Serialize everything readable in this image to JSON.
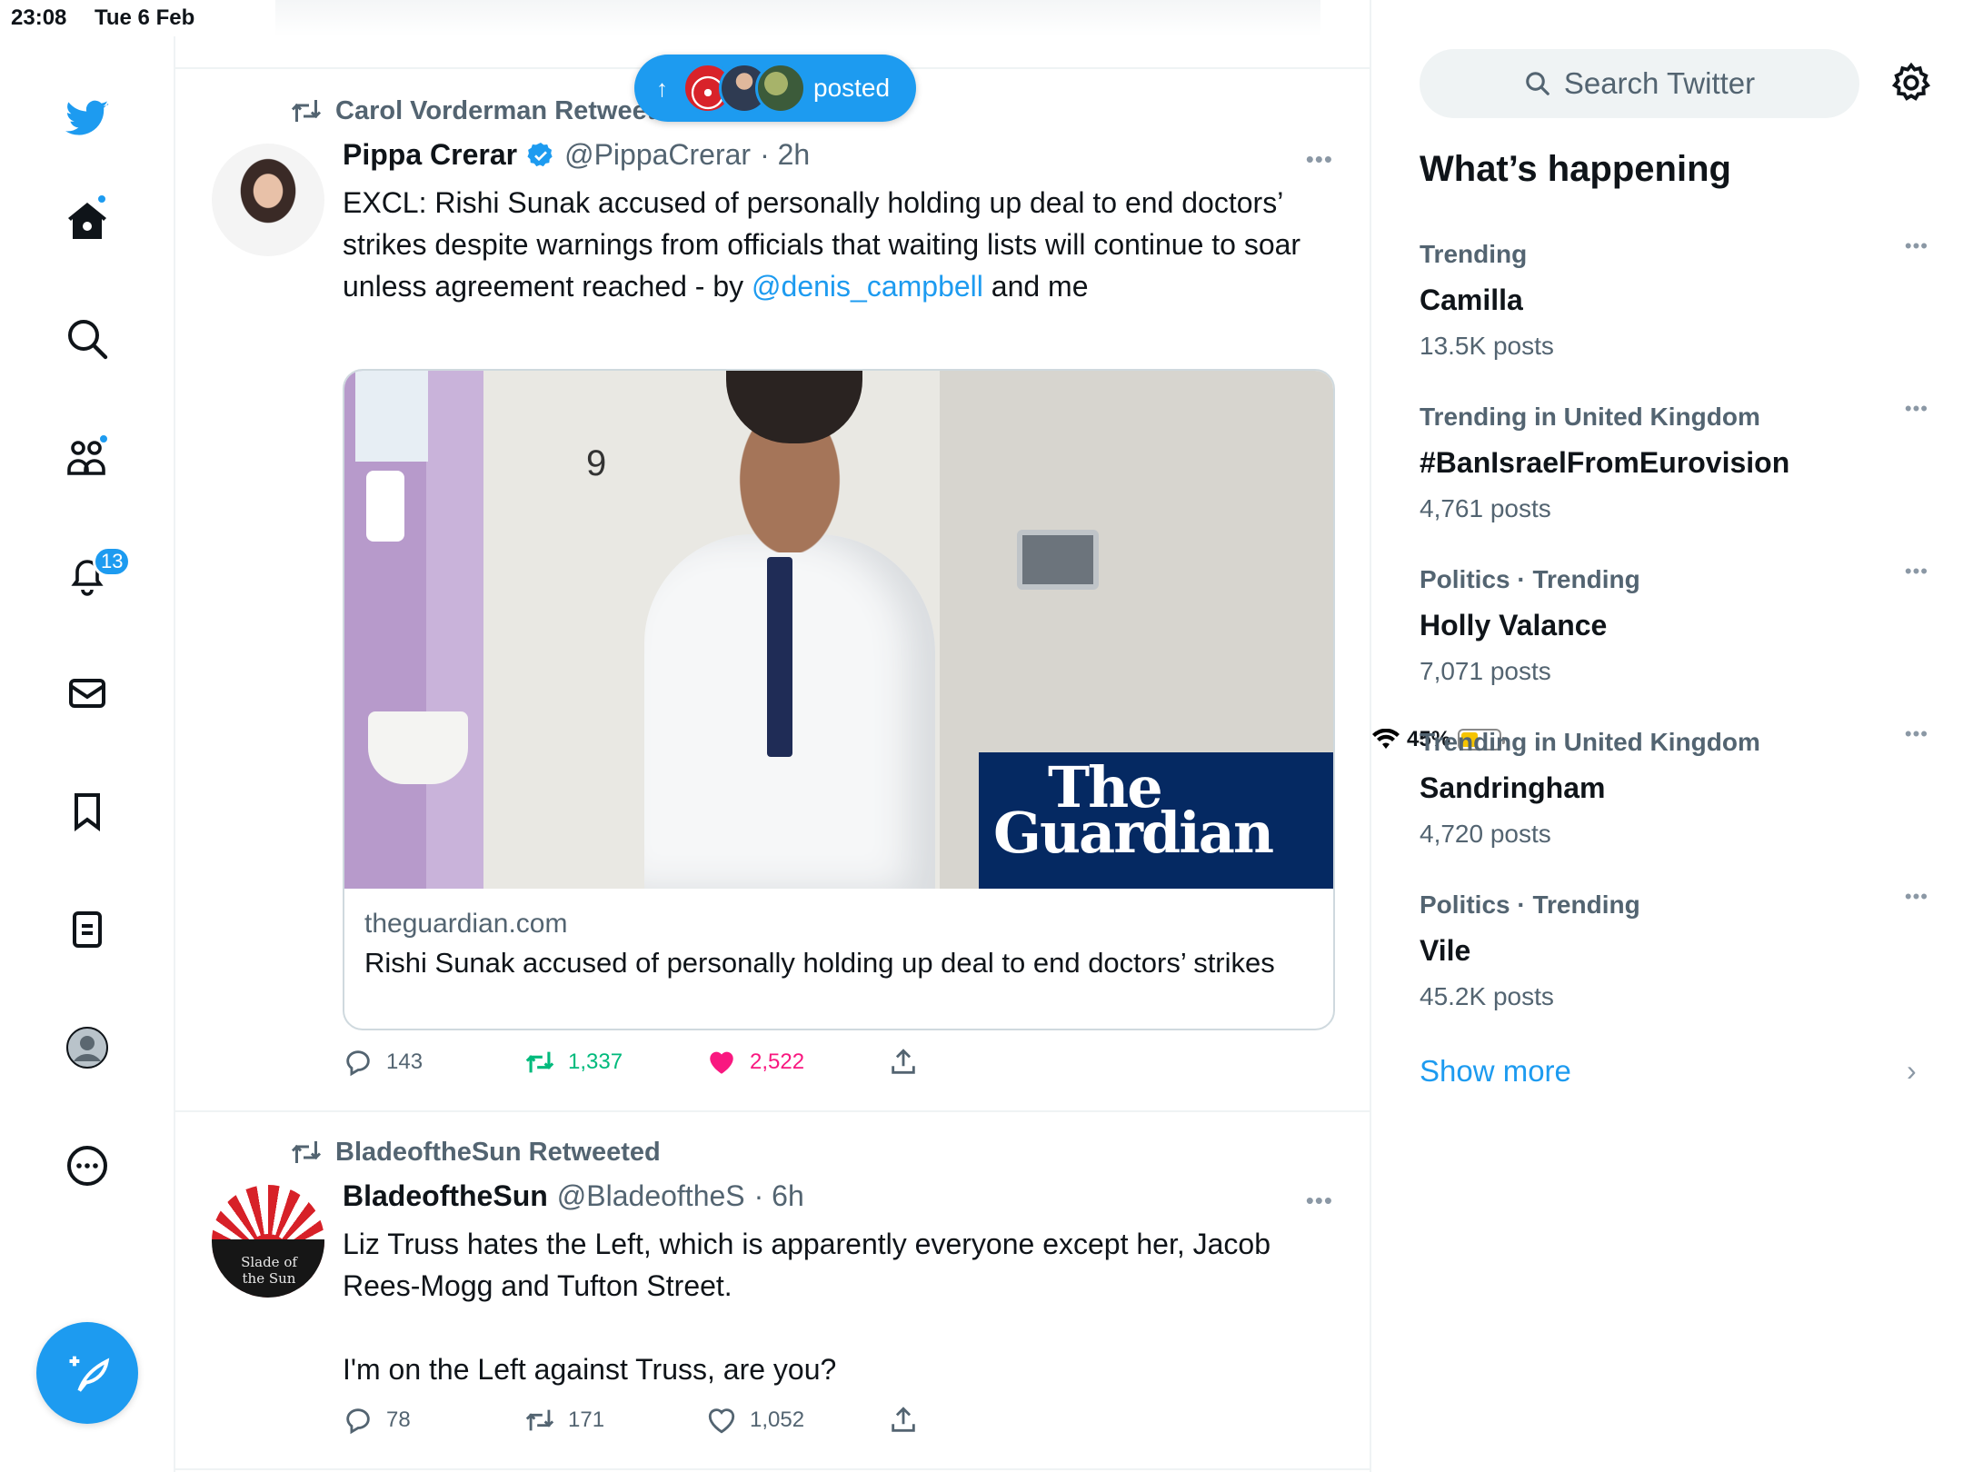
{
  "status_bar": {
    "time": "23:08",
    "date": "Tue 6 Feb",
    "battery": "45%",
    "battery_level": 0.45
  },
  "nav": {
    "notifications_badge": "13"
  },
  "new_posts_pill": {
    "label": "posted"
  },
  "tweets": [
    {
      "retweeted_by": "Carol Vorderman Retweeted",
      "name": "Pippa Crerar",
      "handle": "@PippaCrerar",
      "time": "· 2h",
      "text_before": "EXCL: Rishi Sunak accused of personally holding up deal to end doctors’ strikes despite warnings from officials that waiting lists will continue to soar unless agreement reached - by ",
      "mention": "@denis_campbell",
      "text_after": " and me",
      "card": {
        "image_number": "9",
        "brand_line1": "The",
        "brand_line2": "Guardian",
        "domain": "theguardian.com",
        "title": "Rishi Sunak accused of personally holding up deal to end doctors’ strikes"
      },
      "replies": "143",
      "retweets": "1,337",
      "likes": "2,522"
    },
    {
      "retweeted_by": "BladeoftheSun Retweeted",
      "name": "BladeoftheSun",
      "handle": "@BladeoftheS",
      "time": "· 6h",
      "avatar_text": "Slade of the Sun",
      "text_line1": "Liz Truss hates the Left, which is apparently everyone except her, Jacob Rees-Mogg and Tufton Street.",
      "text_line2": "I'm on the Left against Truss, are you?",
      "replies": "78",
      "retweets": "171",
      "likes": "1,052"
    }
  ],
  "sidebar": {
    "search_placeholder": "Search Twitter",
    "heading": "What’s happening",
    "trends": [
      {
        "context": "Trending",
        "topic": "Camilla",
        "count": "13.5K posts"
      },
      {
        "context": "Trending in United Kingdom",
        "topic": "#BanIsraelFromEurovision",
        "count": "4,761 posts"
      },
      {
        "context": "Politics · Trending",
        "topic": "Holly Valance",
        "count": "7,071 posts"
      },
      {
        "context": "Trending in United Kingdom",
        "topic": "Sandringham",
        "count": "4,720 posts"
      },
      {
        "context": "Politics · Trending",
        "topic": "Vile",
        "count": "45.2K posts"
      }
    ],
    "show_more": "Show more"
  },
  "colors": {
    "accent": "#1d9bf0",
    "retweet": "#00ba7c",
    "like": "#f91880",
    "guardian_blue": "#052962"
  },
  "icons": [
    "twitter-bird-icon",
    "home-icon",
    "search-icon",
    "communities-icon",
    "bell-icon",
    "mail-icon",
    "bookmark-icon",
    "lists-icon",
    "profile-icon",
    "more-circle-icon",
    "compose-icon",
    "retweet-icon",
    "verified-icon",
    "reply-icon",
    "like-icon",
    "share-icon",
    "gear-icon",
    "chevron-right-icon"
  ]
}
